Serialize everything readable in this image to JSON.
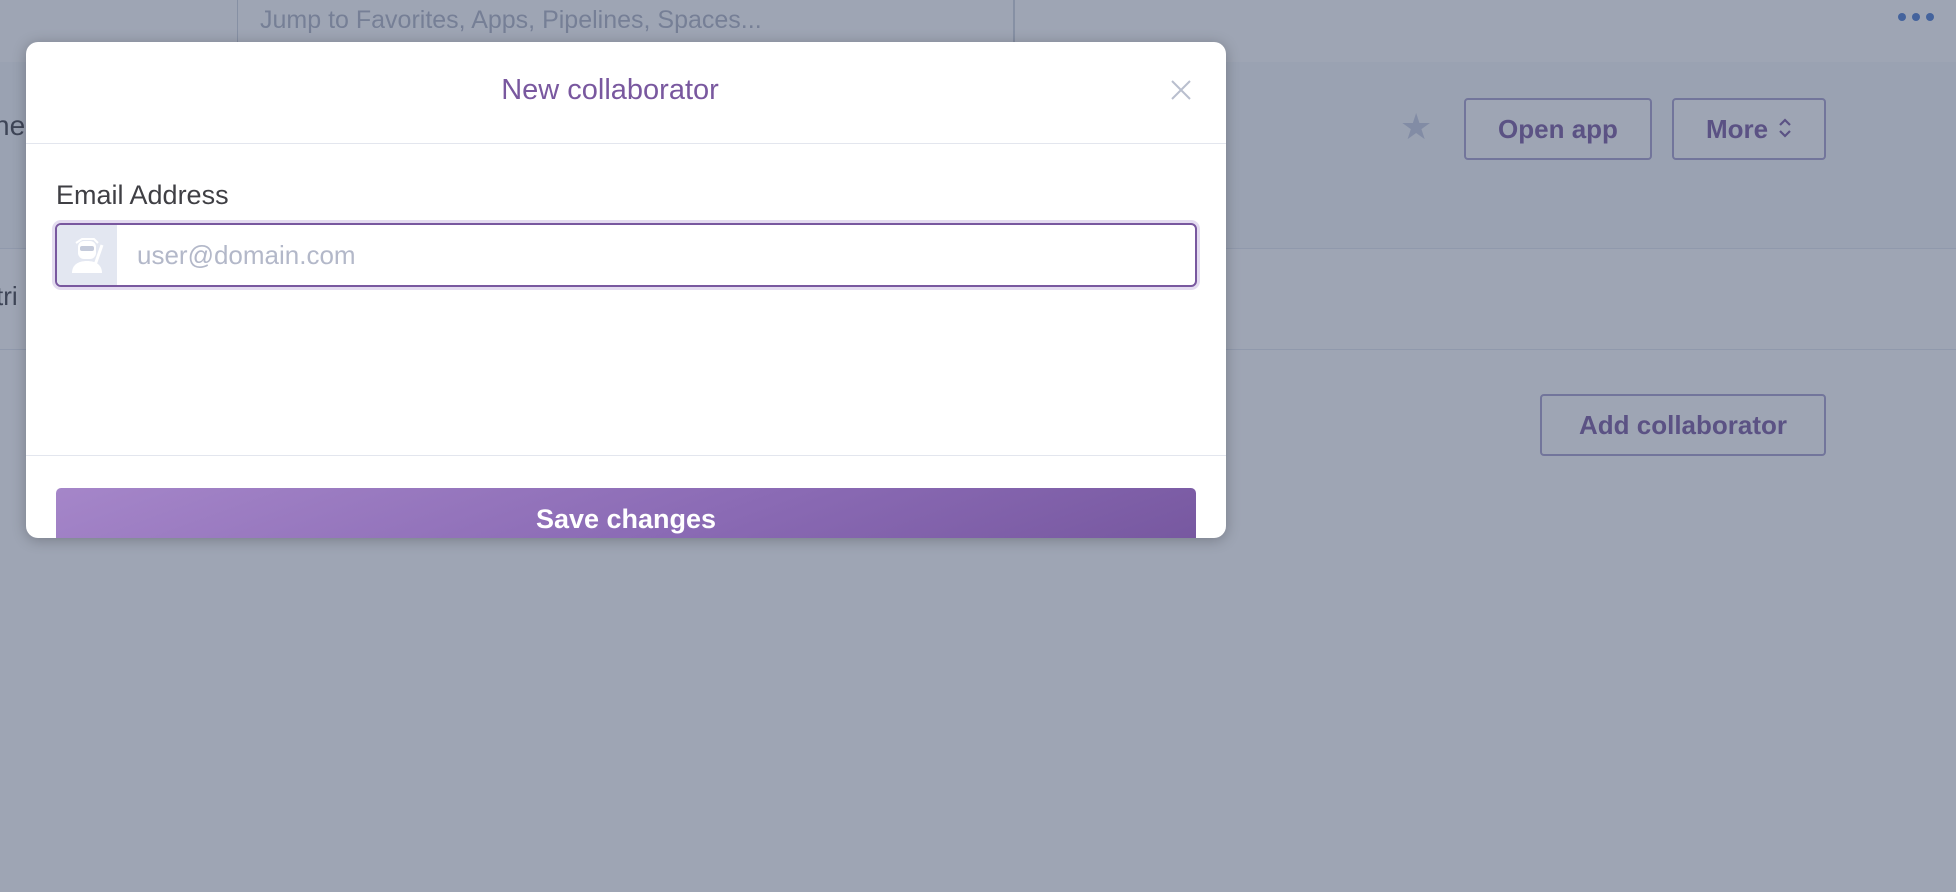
{
  "background": {
    "search_placeholder": "Jump to Favorites, Apps, Pipelines, Spaces...",
    "app_name_fragment": "ne",
    "subnav_fragment": "tri",
    "open_app_label": "Open app",
    "more_label": "More",
    "add_collaborator_label": "Add collaborator"
  },
  "modal": {
    "title": "New collaborator",
    "close_icon": "close-icon",
    "email_label": "Email Address",
    "email_value": "",
    "email_placeholder": "user@domain.com",
    "email_addon_icon": "user-avatar-icon",
    "save_label": "Save changes"
  },
  "colors": {
    "accent": "#79589f",
    "overlay": "rgba(62,76,106,0.5)",
    "topbar_accent": "#79a6dd"
  }
}
